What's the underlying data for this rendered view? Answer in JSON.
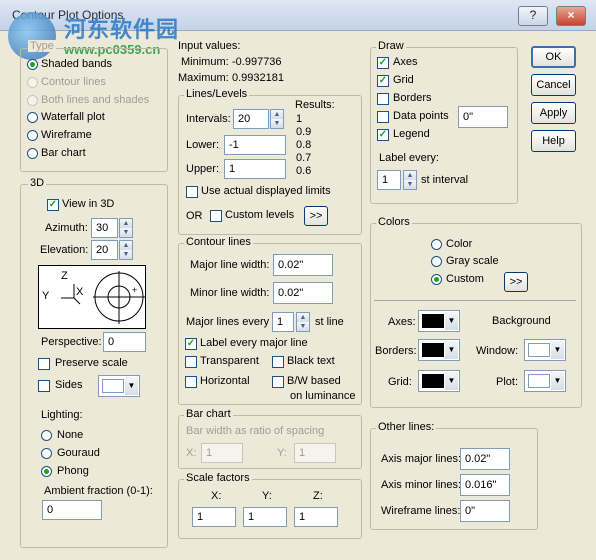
{
  "window": {
    "title": "Contour Plot Options",
    "help_glyph": "?",
    "close_glyph": "×"
  },
  "watermark": {
    "text": "河东软件园",
    "url": "www.pc0359.cn"
  },
  "type": {
    "label": "Type",
    "options": [
      "Shaded bands",
      "Contour lines",
      "Both lines and shades",
      "Waterfall plot",
      "Wireframe",
      "Bar chart"
    ]
  },
  "input_values": {
    "label": "Input values:",
    "min_label": "Minimum:",
    "min": "-0.997736",
    "max_label": "Maximum:",
    "max": "0.9932181"
  },
  "lines_levels": {
    "label": "Lines/Levels",
    "intervals_label": "Intervals:",
    "intervals": "20",
    "lower_label": "Lower:",
    "lower": "-1",
    "upper_label": "Upper:",
    "upper": "1",
    "results_label": "Results:",
    "results": [
      "1",
      "0.9",
      "0.8",
      "0.7",
      "0.6"
    ],
    "actual_label": "Use actual displayed limits",
    "or_label": "OR",
    "custom_label": "Custom levels",
    "more": ">>"
  },
  "threed": {
    "label": "3D",
    "view_label": "View in 3D",
    "azimuth_label": "Azimuth:",
    "azimuth": "30",
    "elevation_label": "Elevation:",
    "elevation": "20",
    "axis_z": "Z",
    "axis_y": "Y",
    "axis_x": "X",
    "perspective_label": "Perspective:",
    "perspective": "0",
    "preserve_label": "Preserve scale",
    "sides_label": "Sides",
    "lighting_label": "Lighting:",
    "lighting": [
      "None",
      "Gouraud",
      "Phong"
    ],
    "ambient_label": "Ambient fraction (0-1):",
    "ambient": "0"
  },
  "contour_lines": {
    "label": "Contour lines",
    "major_width_label": "Major line width:",
    "major_width": "0.02\"",
    "minor_width_label": "Minor line width:",
    "minor_width": "0.02\"",
    "major_every_label": "Major lines every",
    "major_every": "1",
    "st_line": "st line",
    "label_every_major": "Label every major line",
    "transparent": "Transparent",
    "black_text": "Black text",
    "horizontal": "Horizontal",
    "bw_line1": "B/W based",
    "bw_line2": "on luminance"
  },
  "bar_chart": {
    "label": "Bar chart",
    "ratio_label": "Bar width as ratio of spacing",
    "x_label": "X:",
    "x": "1",
    "y_label": "Y:",
    "y": "1"
  },
  "scale": {
    "label": "Scale factors",
    "x_label": "X:",
    "x": "1",
    "y_label": "Y:",
    "y": "1",
    "z_label": "Z:",
    "z": "1"
  },
  "draw": {
    "label": "Draw",
    "axes": "Axes",
    "grid": "Grid",
    "borders": "Borders",
    "data_points": "Data points",
    "data_points_value": "0\"",
    "legend": "Legend",
    "label_every": "Label every:",
    "label_every_value": "1",
    "st_interval": "st interval"
  },
  "colors": {
    "label": "Colors",
    "options": [
      "Color",
      "Gray scale",
      "Custom"
    ],
    "more": ">>",
    "axes_label": "Axes:",
    "background_label": "Background",
    "borders_label": "Borders:",
    "window_label": "Window:",
    "grid_label": "Grid:",
    "plot_label": "Plot:",
    "black": "#000000",
    "white": "#ffffff"
  },
  "other_lines": {
    "label": "Other lines:",
    "axis_major_label": "Axis major lines:",
    "axis_major": "0.02\"",
    "axis_minor_label": "Axis minor lines:",
    "axis_minor": "0.016\"",
    "wireframe_label": "Wireframe lines:",
    "wireframe": "0\""
  },
  "buttons": {
    "ok": "OK",
    "cancel": "Cancel",
    "apply": "Apply",
    "help": "Help"
  }
}
